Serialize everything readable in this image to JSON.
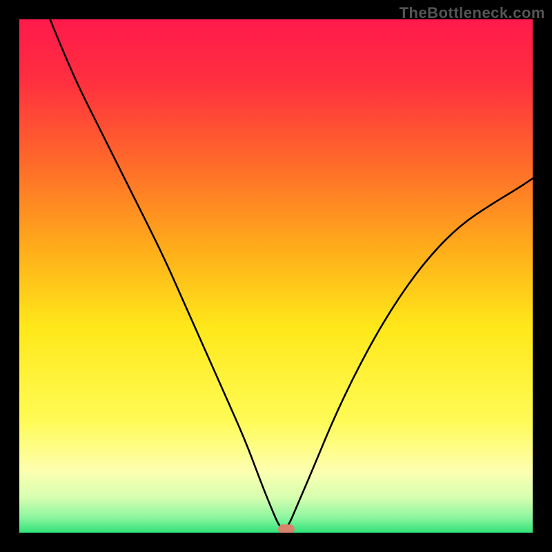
{
  "watermark": "TheBottleneck.com",
  "chart_data": {
    "type": "line",
    "title": "",
    "xlabel": "",
    "ylabel": "",
    "xlim": [
      0,
      100
    ],
    "ylim": [
      0,
      100
    ],
    "grid": false,
    "legend": false,
    "gradient_stops": [
      {
        "pos": 0.0,
        "color": "#ff1a4b"
      },
      {
        "pos": 0.12,
        "color": "#ff2f3f"
      },
      {
        "pos": 0.28,
        "color": "#ff6a2a"
      },
      {
        "pos": 0.45,
        "color": "#ffae1a"
      },
      {
        "pos": 0.6,
        "color": "#ffe81a"
      },
      {
        "pos": 0.78,
        "color": "#fffb55"
      },
      {
        "pos": 0.88,
        "color": "#fdffb0"
      },
      {
        "pos": 0.93,
        "color": "#d8ffb0"
      },
      {
        "pos": 0.97,
        "color": "#8ef5a0"
      },
      {
        "pos": 1.0,
        "color": "#2fe47a"
      }
    ],
    "series": [
      {
        "name": "bottleneck-curve",
        "x": [
          6,
          10,
          16,
          22,
          28,
          32,
          36,
          40,
          44,
          47,
          49,
          50.5,
          51.5,
          52.5,
          54,
          57,
          62,
          68,
          74,
          80,
          86,
          92,
          97,
          100
        ],
        "y": [
          100,
          90,
          78,
          66,
          54,
          45,
          36,
          27,
          18,
          10,
          5,
          1.5,
          0.5,
          1.5,
          5,
          12,
          24,
          36,
          46,
          54,
          60,
          64,
          67,
          69
        ]
      }
    ],
    "marker": {
      "x": 52,
      "y": 0.7,
      "color": "#d6846e"
    }
  }
}
